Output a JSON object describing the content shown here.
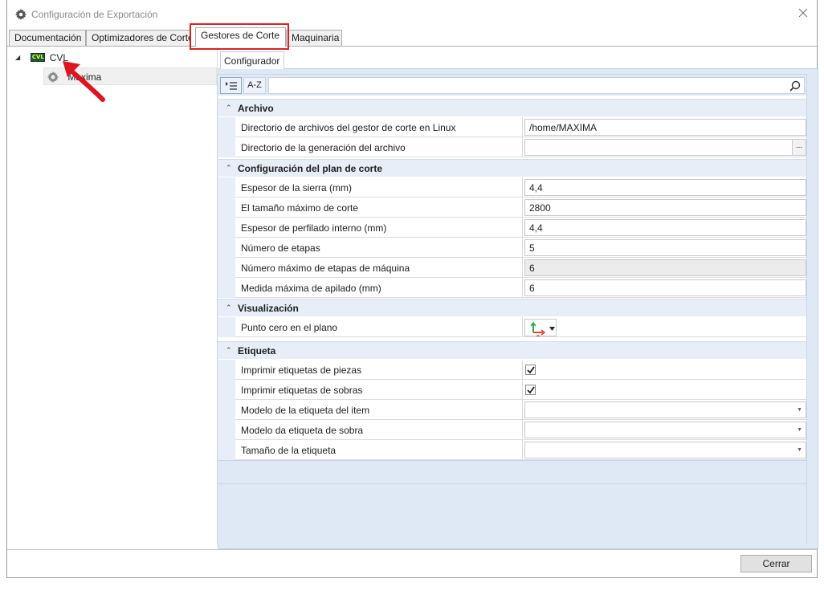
{
  "window": {
    "title": "Configuración de Exportación"
  },
  "tabs": [
    {
      "label": "Documentación",
      "active": false
    },
    {
      "label": "Optimizadores de Corte",
      "active": false
    },
    {
      "label": "Gestores de Corte",
      "active": true
    },
    {
      "label": "Maquinaria",
      "active": false
    }
  ],
  "tree": {
    "root": {
      "icon_text": "CVL",
      "label": "CVL"
    },
    "child": {
      "label": "Maxima"
    }
  },
  "configurator_tab": "Configurador",
  "toolbar": {
    "categorized_label": "",
    "alpha_label": "A-Z",
    "search_value": ""
  },
  "categories": [
    {
      "label": "Archivo",
      "props": [
        {
          "name": "Directorio de archivos del gestor de corte en Linux",
          "type": "text",
          "value": "/home/MAXIMA"
        },
        {
          "name": "Directorio de la generación del archivo",
          "type": "browse",
          "value": "",
          "button": "..."
        }
      ]
    },
    {
      "label": "Configuración del plan de corte",
      "props": [
        {
          "name": "Espesor de la sierra (mm)",
          "type": "text",
          "value": "4,4"
        },
        {
          "name": "El tamaño máximo de corte",
          "type": "text",
          "value": "2800"
        },
        {
          "name": "Espesor de perfilado interno (mm)",
          "type": "text",
          "value": "4,4"
        },
        {
          "name": "Número de etapas",
          "type": "text",
          "value": "5"
        },
        {
          "name": "Número máximo de etapas de máquina",
          "type": "readonly",
          "value": "6"
        },
        {
          "name": "Medida máxima de apilado (mm)",
          "type": "text",
          "value": "6"
        }
      ]
    },
    {
      "label": "Visualización",
      "props": [
        {
          "name": "Punto cero en el plano",
          "type": "origin",
          "value": ""
        }
      ]
    },
    {
      "label": "Etiqueta",
      "props": [
        {
          "name": "Imprimir etiquetas de piezas",
          "type": "checkbox",
          "checked": true
        },
        {
          "name": "Imprimir etiquetas de sobras",
          "type": "checkbox",
          "checked": true
        },
        {
          "name": "Modelo de la etiqueta del item",
          "type": "combo",
          "value": ""
        },
        {
          "name": "Modelo da etiqueta de sobra",
          "type": "combo",
          "value": ""
        },
        {
          "name": "Tamaño de la etiqueta",
          "type": "combo",
          "value": ""
        }
      ]
    }
  ],
  "footer": {
    "close_label": "Cerrar"
  },
  "colors": {
    "highlight": "#e02020",
    "accent": "#dfe9f5",
    "arrow": "#e0141e"
  }
}
